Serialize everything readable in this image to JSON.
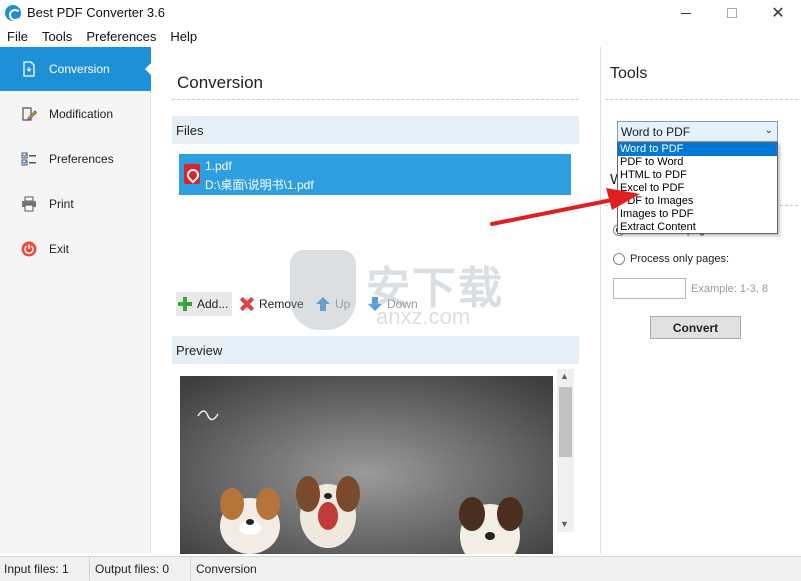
{
  "window": {
    "title": "Best PDF Converter 3.6"
  },
  "menu": [
    "File",
    "Tools",
    "Preferences",
    "Help"
  ],
  "sidebar": {
    "items": [
      {
        "label": "Conversion",
        "icon": "document-convert-icon",
        "active": true
      },
      {
        "label": "Modification",
        "icon": "pencil-document-icon",
        "active": false
      },
      {
        "label": "Preferences",
        "icon": "checklist-icon",
        "active": false
      },
      {
        "label": "Print",
        "icon": "printer-icon",
        "active": false
      },
      {
        "label": "Exit",
        "icon": "power-icon",
        "active": false
      }
    ]
  },
  "main": {
    "title": "Conversion",
    "files_header": "Files",
    "files": [
      {
        "name": "1.pdf",
        "path": "D:\\桌面\\说明书\\1.pdf"
      }
    ],
    "buttons": {
      "add": "Add...",
      "remove": "Remove",
      "up": "Up",
      "down": "Down"
    },
    "preview_header": "Preview"
  },
  "tools": {
    "title": "Tools",
    "selected": "Word to PDF",
    "options": [
      "Word to PDF",
      "PDF to Word",
      "HTML to PDF",
      "Excel to PDF",
      "PDF to Images",
      "Images to PDF",
      "Extract Content"
    ],
    "section_head": "W",
    "process_all_label": "Process all pages",
    "process_only_label": "Process only pages:",
    "pages_value": "",
    "pages_hint": "Example: 1-3, 8",
    "convert_label": "Convert"
  },
  "watermark": {
    "cn": "安下载",
    "sub": "anxz.com"
  },
  "status": {
    "input": "Input files: 1",
    "output": "Output files: 0",
    "mode": "Conversion"
  },
  "colors": {
    "accent": "#1e90d8",
    "file_row": "#2d9ee0",
    "dropdown_selected": "#0078d7",
    "annotation_arrow": "#e02020"
  }
}
